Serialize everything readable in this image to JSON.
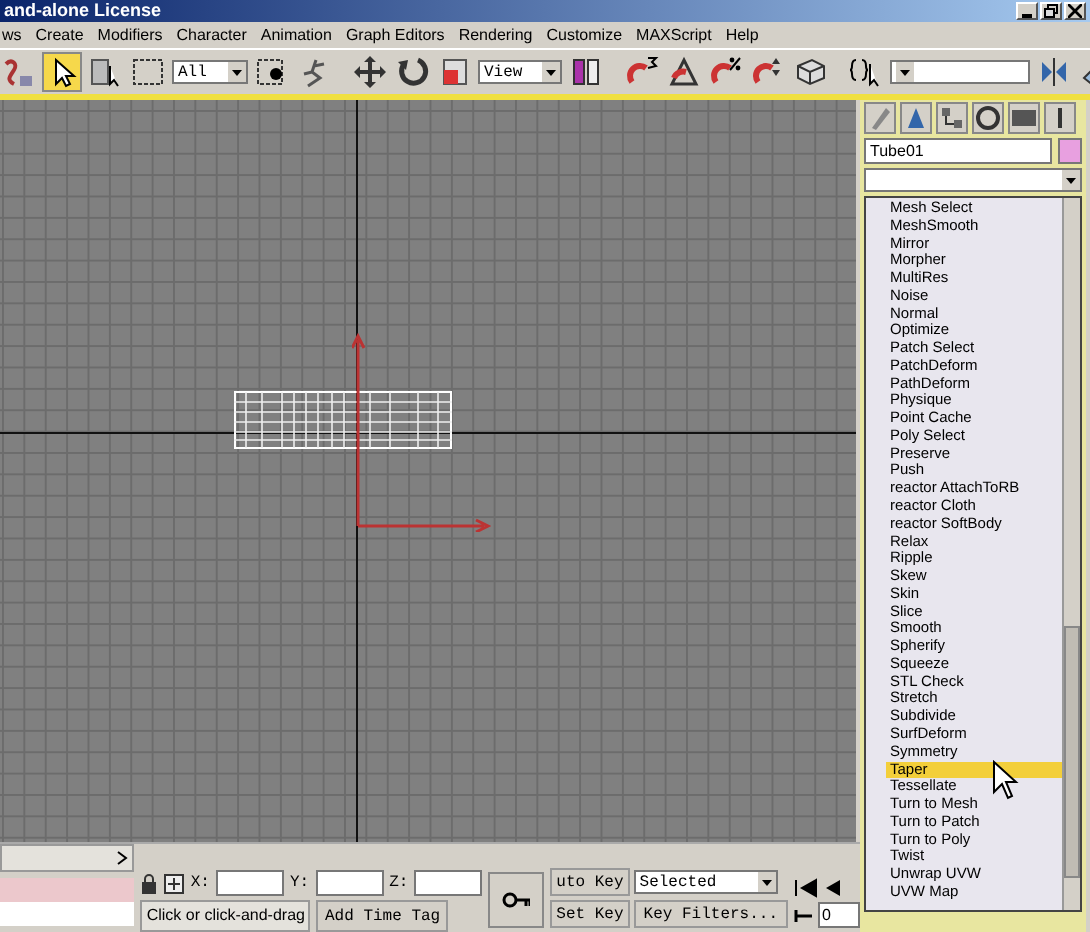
{
  "window": {
    "title": "and-alone License"
  },
  "menu": [
    "ws",
    "Create",
    "Modifiers",
    "Character",
    "Animation",
    "Graph Editors",
    "Rendering",
    "Customize",
    "MAXScript",
    "Help"
  ],
  "toolbar": {
    "selection_filter": "All",
    "coordinate_system": "View"
  },
  "command_panel": {
    "object_name": "Tube01",
    "modifiers": [
      {
        "label": "Mesh Select",
        "selected": false
      },
      {
        "label": "MeshSmooth",
        "selected": false
      },
      {
        "label": "Mirror",
        "selected": false
      },
      {
        "label": "Morpher",
        "selected": false
      },
      {
        "label": "MultiRes",
        "selected": false
      },
      {
        "label": "Noise",
        "selected": false
      },
      {
        "label": "Normal",
        "selected": false
      },
      {
        "label": "Optimize",
        "selected": false
      },
      {
        "label": "Patch Select",
        "selected": false
      },
      {
        "label": "PatchDeform",
        "selected": false
      },
      {
        "label": "PathDeform",
        "selected": false
      },
      {
        "label": "Physique",
        "selected": false
      },
      {
        "label": "Point Cache",
        "selected": false
      },
      {
        "label": "Poly Select",
        "selected": false
      },
      {
        "label": "Preserve",
        "selected": false
      },
      {
        "label": "Push",
        "selected": false
      },
      {
        "label": "reactor AttachToRB",
        "selected": false
      },
      {
        "label": "reactor Cloth",
        "selected": false
      },
      {
        "label": "reactor SoftBody",
        "selected": false
      },
      {
        "label": "Relax",
        "selected": false
      },
      {
        "label": "Ripple",
        "selected": false
      },
      {
        "label": "Skew",
        "selected": false
      },
      {
        "label": "Skin",
        "selected": false
      },
      {
        "label": "Slice",
        "selected": false
      },
      {
        "label": "Smooth",
        "selected": false
      },
      {
        "label": "Spherify",
        "selected": false
      },
      {
        "label": "Squeeze",
        "selected": false
      },
      {
        "label": "STL Check",
        "selected": false
      },
      {
        "label": "Stretch",
        "selected": false
      },
      {
        "label": "Subdivide",
        "selected": false
      },
      {
        "label": "SurfDeform",
        "selected": false
      },
      {
        "label": "Symmetry",
        "selected": false
      },
      {
        "label": "Taper",
        "selected": true
      },
      {
        "label": "Tessellate",
        "selected": false
      },
      {
        "label": "Turn to Mesh",
        "selected": false
      },
      {
        "label": "Turn to Patch",
        "selected": false
      },
      {
        "label": "Turn to Poly",
        "selected": false
      },
      {
        "label": "Twist",
        "selected": false
      },
      {
        "label": "Unwrap UVW",
        "selected": false
      },
      {
        "label": "UVW Map",
        "selected": false
      }
    ]
  },
  "status": {
    "prompt": "Click or click-and-drag",
    "time_tag": "Add Time Tag",
    "x_label": "X:",
    "y_label": "Y:",
    "z_label": "Z:",
    "auto_key": "uto Key",
    "set_key": "Set Key",
    "key_mode": "Selected",
    "key_filters": "Key Filters...",
    "frame": "0"
  }
}
